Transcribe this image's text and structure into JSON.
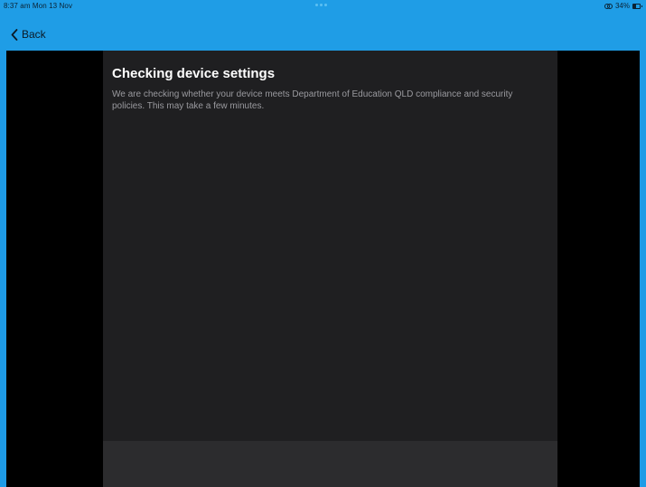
{
  "status_bar": {
    "time": "8:37 am  Mon 13 Nov",
    "battery_percent": "34%",
    "icons": [
      "link-icon",
      "battery-icon"
    ]
  },
  "nav": {
    "back_label": "Back",
    "back_icon": "chevron-left-icon"
  },
  "main": {
    "title": "Checking device settings",
    "description": "We are checking whether your device meets Department of Education QLD compliance and security policies. This may take a few minutes."
  },
  "colors": {
    "accent": "#1f9de6",
    "panel": "#1f1f21",
    "background": "#000000"
  }
}
